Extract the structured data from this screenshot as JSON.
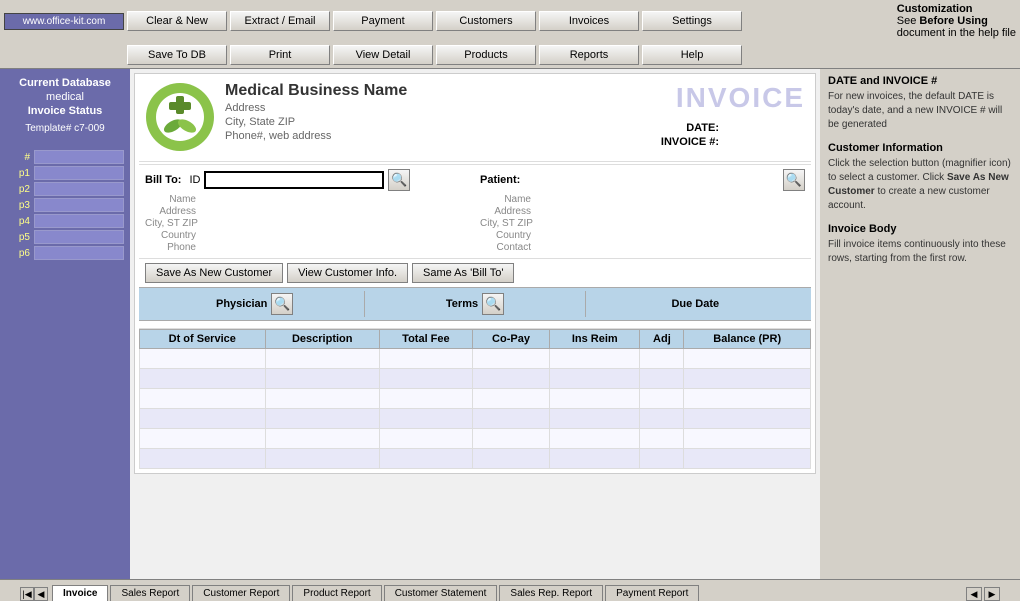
{
  "app": {
    "logo_text": "www.office-kit.com"
  },
  "toolbar": {
    "row1": {
      "btn_clear": "Clear & New",
      "btn_extract": "Extract / Email",
      "btn_payment": "Payment",
      "btn_customers": "Customers",
      "btn_invoices": "Invoices",
      "btn_settings": "Settings"
    },
    "row2": {
      "btn_savetodb": "Save To DB",
      "btn_print": "Print",
      "btn_viewdetail": "View Detail",
      "btn_products": "Products",
      "btn_reports": "Reports",
      "btn_help": "Help"
    },
    "right_title": "Customization",
    "right_line1": "See ",
    "right_bold": "Before Using",
    "right_line2": "document in the help file"
  },
  "sidebar": {
    "label1": "Current Database",
    "label2": "medical",
    "label3": "Invoice Status",
    "label4": "Template# c7-009",
    "rows": [
      {
        "num": "#"
      },
      {
        "num": "p1"
      },
      {
        "num": "p2"
      },
      {
        "num": "p3"
      },
      {
        "num": "p4"
      },
      {
        "num": "p5"
      },
      {
        "num": "p6"
      }
    ]
  },
  "invoice": {
    "company_name": "Medical Business Name",
    "address": "Address",
    "city_state": "City, State ZIP",
    "phone_web": "Phone#, web address",
    "watermark": "INVOICE",
    "date_label": "DATE:",
    "invoice_label": "INVOICE #:",
    "bill_to_label": "Bill To:",
    "bill_to_id": "ID",
    "bill_to_id_value": "",
    "name_label": "Name",
    "address_label": "Address",
    "city_label": "City, ST ZIP",
    "country_label": "Country",
    "phone_label": "Phone",
    "patient_label": "Patient:",
    "pat_name_label": "Name",
    "pat_address_label": "Address",
    "pat_city_label": "City, ST ZIP",
    "pat_country_label": "Country",
    "pat_contact_label": "Contact",
    "physician_label": "Physician",
    "terms_label": "Terms",
    "due_date_label": "Due Date",
    "table_headers": [
      "Dt of Service",
      "Description",
      "Total Fee",
      "Co-Pay",
      "Ins Reim",
      "Adj",
      "Balance (PR)"
    ],
    "table_rows": [
      [
        "",
        "",
        "",
        "",
        "",
        "",
        ""
      ],
      [
        "",
        "",
        "",
        "",
        "",
        "",
        ""
      ],
      [
        "",
        "",
        "",
        "",
        "",
        "",
        ""
      ],
      [
        "",
        "",
        "",
        "",
        "",
        "",
        ""
      ],
      [
        "",
        "",
        "",
        "",
        "",
        "",
        ""
      ],
      [
        "",
        "",
        "",
        "",
        "",
        "",
        ""
      ]
    ],
    "btn_save_new": "Save As New Customer",
    "btn_view_info": "View Customer Info.",
    "btn_same_as": "Same As 'Bill To'"
  },
  "info_panel": {
    "section1_title": "DATE and INVOICE #",
    "section1_text": "For new invoices, the default DATE is today's date, and a new INVOICE # will be generated",
    "section2_title": "Customer Information",
    "section2_text1": "Click the selection button (magnifier icon) to select a customer. Click ",
    "section2_bold": "Save As New Customer",
    "section2_text2": " to create a new customer account.",
    "section3_title": "Invoice Body",
    "section3_text": "Fill invoice items continuously into these rows, starting from the first row."
  },
  "tabs": [
    {
      "label": "Invoice",
      "active": true
    },
    {
      "label": "Sales Report",
      "active": false
    },
    {
      "label": "Customer Report",
      "active": false
    },
    {
      "label": "Product Report",
      "active": false
    },
    {
      "label": "Customer Statement",
      "active": false
    },
    {
      "label": "Sales Rep. Report",
      "active": false
    },
    {
      "label": "Payment Report",
      "active": false
    }
  ]
}
